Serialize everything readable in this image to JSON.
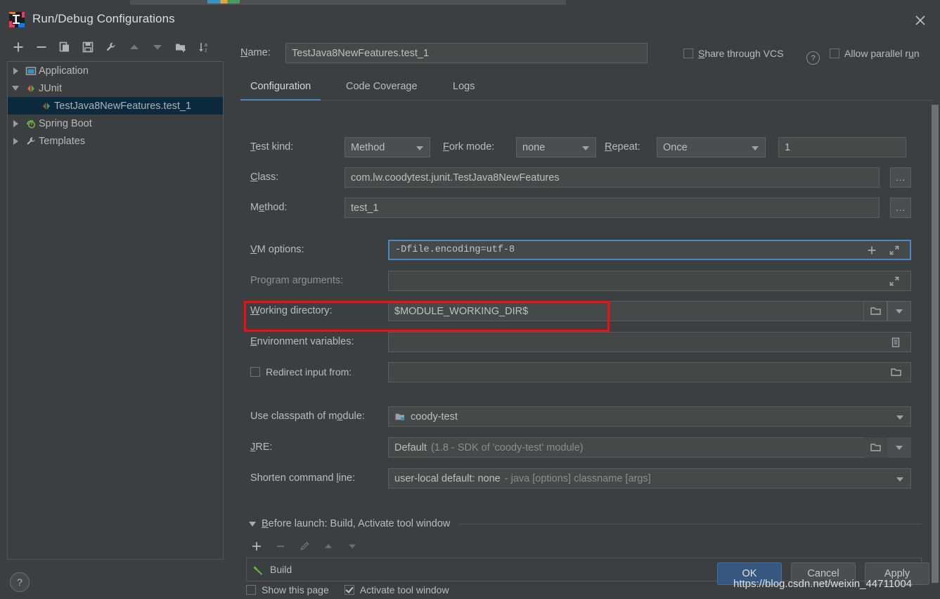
{
  "window": {
    "title": "Run/Debug Configurations",
    "app_icon": "intellij-idea-icon",
    "close_icon": "close-icon"
  },
  "sidebar": {
    "toolbar": [
      {
        "name": "add-configuration-button",
        "icon": "plus-icon",
        "label": "+"
      },
      {
        "name": "remove-configuration-button",
        "icon": "minus-icon",
        "label": "−"
      },
      {
        "name": "copy-configuration-button",
        "icon": "copy-icon",
        "label": ""
      },
      {
        "name": "save-configuration-button",
        "icon": "save-icon",
        "label": ""
      },
      {
        "name": "edit-defaults-button",
        "icon": "wrench-icon",
        "label": ""
      },
      {
        "name": "move-up-button",
        "icon": "arrow-up-icon",
        "label": ""
      },
      {
        "name": "move-down-button",
        "icon": "arrow-down-icon",
        "label": ""
      },
      {
        "name": "new-folder-button",
        "icon": "folder-add-icon",
        "label": ""
      },
      {
        "name": "sort-configurations-button",
        "icon": "sort-az-icon",
        "label": ""
      }
    ],
    "tree": [
      {
        "label": "Application",
        "icon": "application-icon",
        "expandable": true,
        "expanded": false,
        "indent": 0,
        "selected": false
      },
      {
        "label": "JUnit",
        "icon": "junit-icon",
        "expandable": true,
        "expanded": true,
        "indent": 0,
        "selected": false
      },
      {
        "label": "TestJava8NewFeatures.test_1",
        "icon": "junit-run-icon",
        "expandable": false,
        "expanded": false,
        "indent": 1,
        "selected": true
      },
      {
        "label": "Spring Boot",
        "icon": "spring-boot-icon",
        "expandable": true,
        "expanded": false,
        "indent": 0,
        "selected": false
      },
      {
        "label": "Templates",
        "icon": "templates-wrench-icon",
        "expandable": true,
        "expanded": false,
        "indent": 0,
        "selected": false
      }
    ],
    "help_label": "?"
  },
  "header": {
    "name_label": "Name:",
    "name_value": "TestJava8NewFeatures.test_1",
    "share_label": "Share through VCS",
    "share_checked": false,
    "share_help": "?",
    "parallel_label": "Allow parallel run",
    "parallel_checked": false
  },
  "tabs": [
    {
      "label": "Configuration",
      "active": true
    },
    {
      "label": "Code Coverage",
      "active": false
    },
    {
      "label": "Logs",
      "active": false
    }
  ],
  "form": {
    "test_kind_label": "Test kind:",
    "test_kind_value": "Method",
    "fork_mode_label": "Fork mode:",
    "fork_mode_value": "none",
    "repeat_label": "Repeat:",
    "repeat_value": "Once",
    "repeat_count": "1",
    "class_label": "Class:",
    "class_value": "com.lw.coodytest.junit.TestJava8NewFeatures",
    "class_browse": "...",
    "method_label": "Method:",
    "method_value": "test_1",
    "method_browse": "...",
    "vm_options_label": "VM options:",
    "vm_options_value": "-Dfile.encoding=utf-8",
    "vm_options_add_icon": "plus-icon",
    "vm_options_expand_icon": "expand-icon",
    "program_arguments_label": "Program arguments:",
    "program_arguments_value": "",
    "program_arguments_expand_icon": "expand-icon",
    "working_directory_label": "Working directory:",
    "working_directory_value": "$MODULE_WORKING_DIR$",
    "working_directory_browse_icon": "folder-icon",
    "working_directory_history_icon": "chevron-down-icon",
    "environment_variables_label": "Environment variables:",
    "environment_variables_value": "",
    "environment_variables_icon": "list-edit-icon",
    "redirect_input_label": "Redirect input from:",
    "redirect_input_checked": false,
    "redirect_input_value": "",
    "redirect_input_browse_icon": "folder-icon",
    "classpath_label": "Use classpath of module:",
    "classpath_value": "coody-test",
    "classpath_icon": "module-icon",
    "jre_label": "JRE:",
    "jre_value": "Default",
    "jre_value_hint": "(1.8 - SDK of 'coody-test' module)",
    "jre_browse_icon": "folder-icon",
    "shorten_label": "Shorten command line:",
    "shorten_value": "user-local default: none",
    "shorten_value_hint": "- java [options] classname [args]"
  },
  "before_launch": {
    "title": "Before launch: Build, Activate tool window",
    "toolbar": [
      {
        "name": "add-task-button",
        "icon": "plus-icon"
      },
      {
        "name": "remove-task-button",
        "icon": "minus-icon"
      },
      {
        "name": "edit-task-button",
        "icon": "pencil-icon"
      },
      {
        "name": "move-task-up-button",
        "icon": "arrow-up-icon"
      },
      {
        "name": "move-task-down-button",
        "icon": "arrow-down-icon"
      }
    ],
    "tasks": [
      {
        "label": "Build",
        "icon": "build-hammer-icon"
      }
    ],
    "show_page_label": "Show this page",
    "show_page_checked": false,
    "activate_tool_window_label": "Activate tool window",
    "activate_tool_window_checked": true
  },
  "footer": {
    "ok_label": "OK",
    "cancel_label": "Cancel",
    "apply_label": "Apply"
  },
  "watermark": "https://blog.csdn.net/weixin_44711004",
  "colors": {
    "background": "#3c3f41",
    "field": "#45494a",
    "accent_blue": "#4a88c7",
    "highlight_red": "#f50d0d",
    "selection": "#0d293e",
    "primary_button": "#365880"
  }
}
